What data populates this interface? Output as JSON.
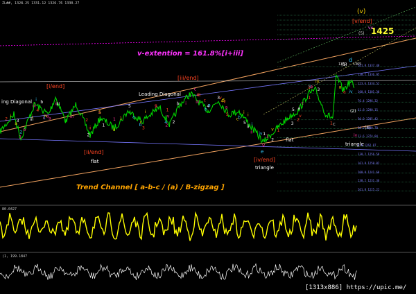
{
  "header": {
    "symbol_text": "ZL##, 1328.25 1331.12 1326.76 1330.27",
    "target_label": "1425",
    "extension_label": "v-extention = 161.8%[i+iii]",
    "channel_label": "Trend Channel  [ a-b-c / (a) / B-zigzag ]",
    "range_label": "1362 - 1365",
    "watermark": "[1313x886] https://upic.me/"
  },
  "colors": {
    "bg": "#000000",
    "price": "#00d400",
    "osc1": "#ffff00",
    "osc2": "#ffffff",
    "channel": "#f4a460",
    "extension": "#ff00ff",
    "wave_red": "#ff3b30",
    "wave_yellow": "#ffd700",
    "wave_cyan": "#00bfff",
    "wave_pink": "#ff3399",
    "fib": "#7fff7f"
  },
  "indicator_labels": {
    "osc1_value": "80.0427",
    "osc2_value": "(1, 199.1847"
  },
  "wave_labels": {
    "ending_diagonal_left": "ing Diagonal",
    "leading_diagonal": "Leading Diagonal",
    "i_end": "[i/end]",
    "ii_end": "[ii/end]",
    "iii_end": "[iii/end]",
    "iv_end": "[iv/end]",
    "v_end": "[v/end]",
    "v_big": "(v)",
    "vx": "vx",
    "five": "(5)",
    "flat1": "flat",
    "flat2": "flat",
    "triangle1": "triangle",
    "triangle2": "triangle",
    "one": "(1)",
    "two": "(2)",
    "four": "(4)",
    "d": "d",
    "c": "c",
    "e": "e",
    "v_small": "v",
    "iv_small": "iv"
  },
  "fib_levels": [
    {
      "pct": "161.8",
      "price": "1337.48"
    },
    {
      "pct": "138.2",
      "price": "1336.95"
    },
    {
      "pct": "123.6",
      "price": "1334.52"
    },
    {
      "pct": "100.0",
      "price": "1301.30"
    },
    {
      "pct": "76.4",
      "price": "1296.32"
    },
    {
      "pct": "61.8",
      "price": "1290.15"
    },
    {
      "pct": "50.0",
      "price": "1285.42"
    },
    {
      "pct": "38.2",
      "price": "1280.78"
    },
    {
      "pct": "23.6",
      "price": "1274.04"
    },
    {
      "pct": "0.0",
      "price": "1262.87"
    },
    {
      "pct": "138.2",
      "price": "1256.58"
    },
    {
      "pct": "161.8",
      "price": "1250.82"
    },
    {
      "pct": "200.0",
      "price": "1241.60"
    },
    {
      "pct": "238.2",
      "price": "1231.36"
    },
    {
      "pct": "261.8",
      "price": "1225.22"
    }
  ]
}
